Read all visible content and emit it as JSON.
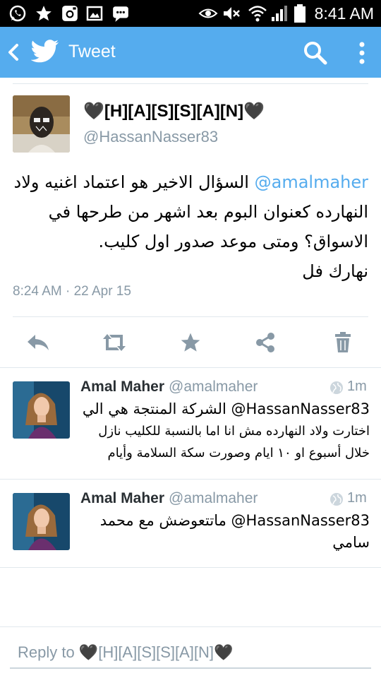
{
  "status_bar": {
    "time": "8:41 AM",
    "left_icons": [
      "whatsapp-icon",
      "star-icon",
      "instagram-icon",
      "gallery-icon",
      "messenger-icon"
    ],
    "right_icons": [
      "eye-icon",
      "mute-icon",
      "wifi-icon",
      "signal-icon",
      "battery-icon"
    ]
  },
  "action_bar": {
    "title": "Tweet",
    "color": "#55acee",
    "icons": [
      "back-icon",
      "twitter-bird-icon",
      "search-icon",
      "more-icon"
    ]
  },
  "main_tweet": {
    "author_name": "🖤[H][A][S][S][A][N]🖤",
    "author_handle": "@HassanNasser83",
    "mention": "@amalmaher",
    "text_line1": "السؤال الاخير هو اعتماد اغنيه ولاد",
    "text_line2": "النهارده كعنوان البوم بعد اشهر من طرحها في",
    "text_line3": "الاسواق؟ ومتى موعد صدور اول كليب.",
    "text_line4": "نهارك فل",
    "timestamp": "8:24 AM · 22 Apr 15",
    "action_icons": [
      "reply-icon",
      "retweet-icon",
      "favorite-icon",
      "share-icon",
      "delete-icon"
    ]
  },
  "replies": [
    {
      "name": "Amal Maher",
      "handle": "@amalmaher",
      "time": "1m",
      "mention": "@HassanNasser83",
      "line1": "الشركة المنتجة هي الي",
      "line2": "اختارت ولاد النهارده مش انا اما بالنسبة للكليب نازل",
      "line3": "خلال أسبوع او ١٠ ايام وصورت سكة السلامة وأيام"
    },
    {
      "name": "Amal Maher",
      "handle": "@amalmaher",
      "time": "1m",
      "mention": "@HassanNasser83",
      "line1": "ماتتعوضش مع محمد",
      "line2": "سامي"
    }
  ],
  "composer": {
    "placeholder": "Reply to 🖤[H][A][S][S][A][N]🖤"
  }
}
